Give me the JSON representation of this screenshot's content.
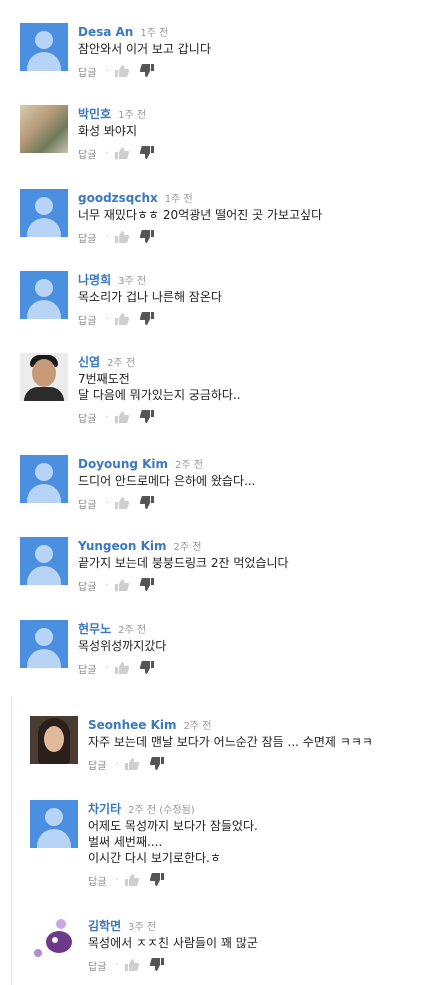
{
  "labels": {
    "reply": "답글",
    "separator": "·"
  },
  "comments": [
    {
      "author": "Desa An",
      "time": "1주 전",
      "lines": [
        "잠안와서 이거 보고 갑니다"
      ]
    },
    {
      "author": "박민호",
      "time": "1주 전",
      "lines": [
        "화성 봐야지"
      ]
    },
    {
      "author": "goodzsqchx",
      "time": "1주 전",
      "lines": [
        "너무 재밌다ㅎㅎ 20억광년 떨어진 곳 가보고싶다"
      ]
    },
    {
      "author": "나명희",
      "time": "3주 전",
      "lines": [
        "목소리가 겁나 나른해 잠온다"
      ]
    },
    {
      "author": "신엽",
      "time": "2주 전",
      "lines": [
        "7번째도전",
        "달 다음에 뭐가있는지 궁금하다.."
      ]
    },
    {
      "author": "Doyoung Kim",
      "time": "2주 전",
      "lines": [
        "드디어 안드로메다 은하에 왔습다..."
      ]
    },
    {
      "author": "Yungeon Kim",
      "time": "2주 전",
      "lines": [
        "끝가지 보는데 붕붕드링크 2잔 먹었습니다"
      ]
    },
    {
      "author": "현무노",
      "time": "2주 전",
      "lines": [
        "목성위성까지갔다"
      ]
    },
    {
      "author": "Seonhee Kim",
      "time": "2주 전",
      "lines": [
        "자주 보는데 맨날 보다가 어느순간 잠듬 ... 수면제 ㅋㅋㅋ"
      ]
    },
    {
      "author": "차기타",
      "time": "2주 전 (수정됨)",
      "lines": [
        "어제도 목성까지 보다가 잠들었다.",
        "벌써 세번째....",
        "이시간 다시 보기로한다.ㅎ"
      ]
    },
    {
      "author": "김학면",
      "time": "3주 전",
      "lines": [
        "목성에서 ㅈㅈ친 사람들이 꽤 많군"
      ]
    }
  ]
}
